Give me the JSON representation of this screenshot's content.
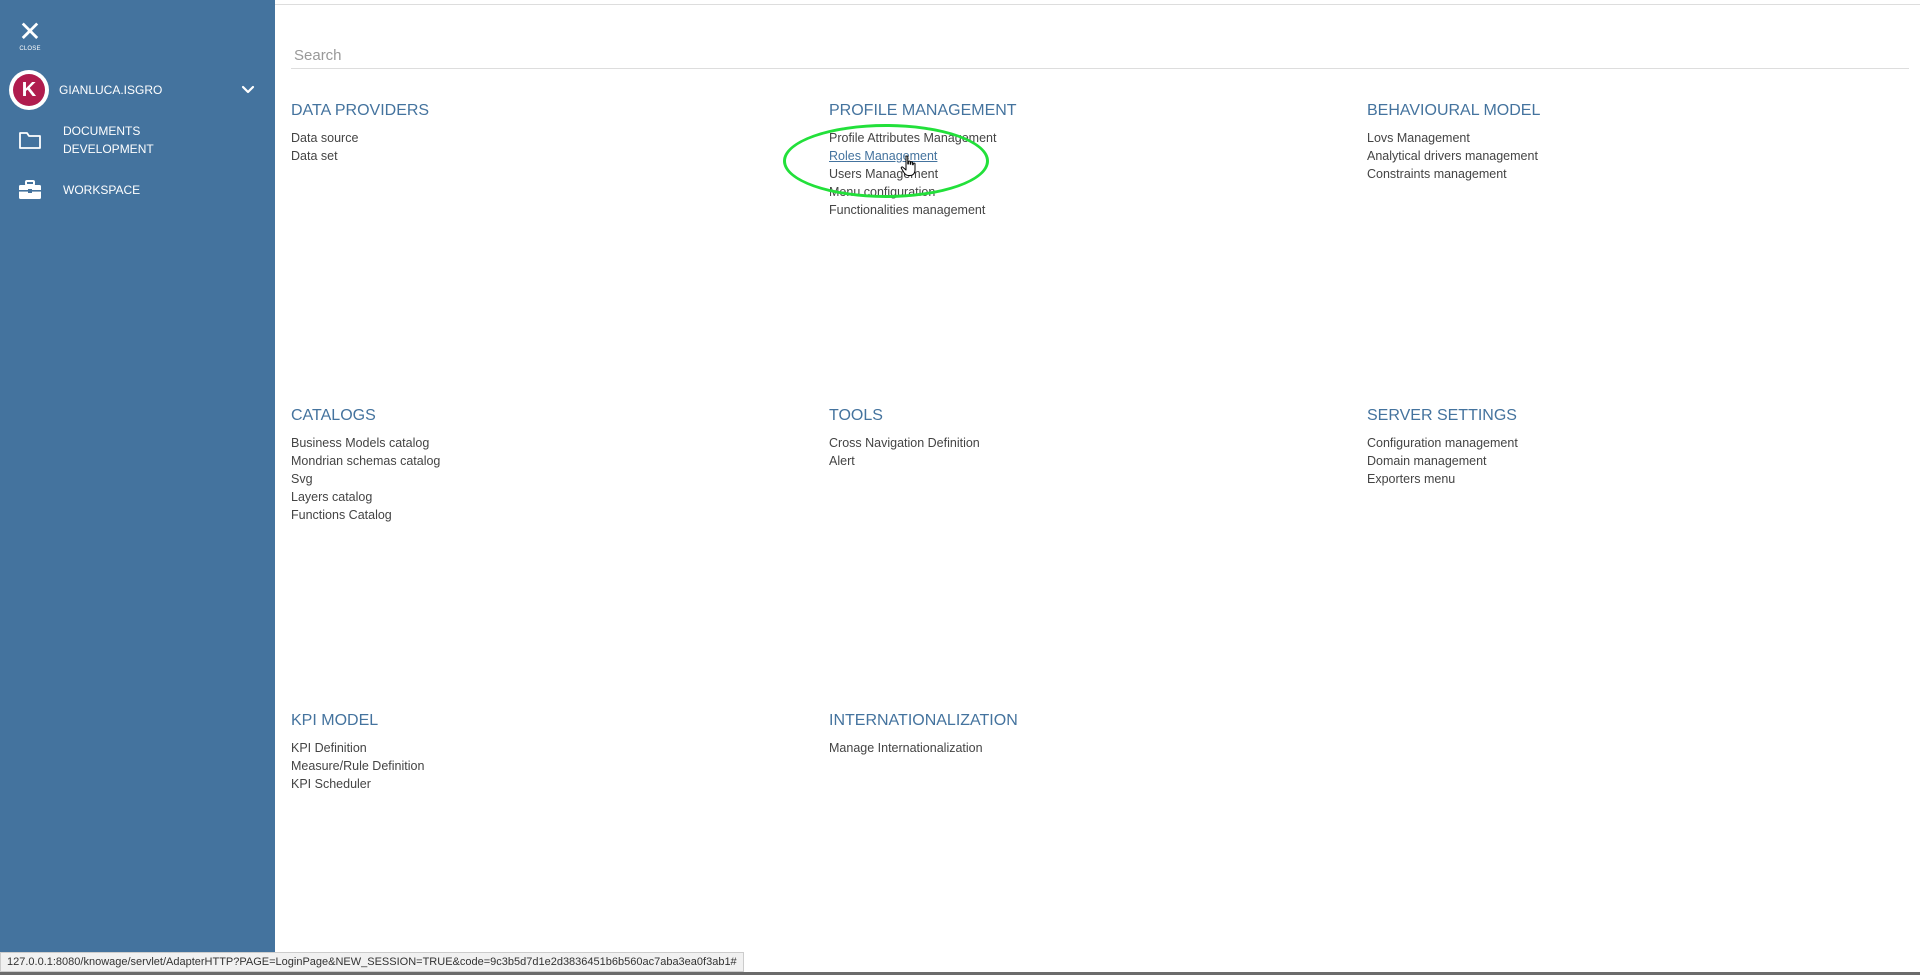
{
  "sidebar": {
    "close_label": "CLOSE",
    "user": {
      "avatar_letter": "K",
      "name": "GIANLUCA.ISGRO"
    },
    "items": [
      {
        "label": "DOCUMENTS DEVELOPMENT",
        "icon": "folder-icon"
      },
      {
        "label": "WORKSPACE",
        "icon": "briefcase-icon"
      }
    ],
    "colors": {
      "background": "#44739e",
      "avatar_brand": "#b01c4e"
    }
  },
  "search": {
    "placeholder": "Search"
  },
  "sections": [
    {
      "title": "DATA PROVIDERS",
      "links": [
        "Data source",
        "Data set"
      ]
    },
    {
      "title": "PROFILE MANAGEMENT",
      "links": [
        "Profile Attributes Management",
        "Roles Management",
        "Users Management",
        "Menu configuration",
        "Functionalities management"
      ]
    },
    {
      "title": "BEHAVIOURAL MODEL",
      "links": [
        "Lovs Management",
        "Analytical drivers management",
        "Constraints management"
      ]
    },
    {
      "title": "CATALOGS",
      "links": [
        "Business Models catalog",
        "Mondrian schemas catalog",
        "Svg",
        "Layers catalog",
        "Functions Catalog"
      ]
    },
    {
      "title": "TOOLS",
      "links": [
        "Cross Navigation Definition",
        "Alert"
      ]
    },
    {
      "title": "SERVER SETTINGS",
      "links": [
        "Configuration management",
        "Domain management",
        "Exporters menu"
      ]
    },
    {
      "title": "KPI MODEL",
      "links": [
        "KPI Definition",
        "Measure/Rule Definition",
        "KPI Scheduler"
      ]
    },
    {
      "title": "INTERNATIONALIZATION",
      "links": [
        "Manage Internationalization"
      ]
    }
  ],
  "hovered_link": "Roles Management",
  "status_url": "127.0.0.1:8080/knowage/servlet/AdapterHTTP?PAGE=LoginPage&NEW_SESSION=TRUE&code=9c3b5d7d1e2d3836451b6b560ac7aba3ea0f3ab1#",
  "colors": {
    "accent": "#44739e",
    "highlight_annotation": "#22e03a"
  }
}
